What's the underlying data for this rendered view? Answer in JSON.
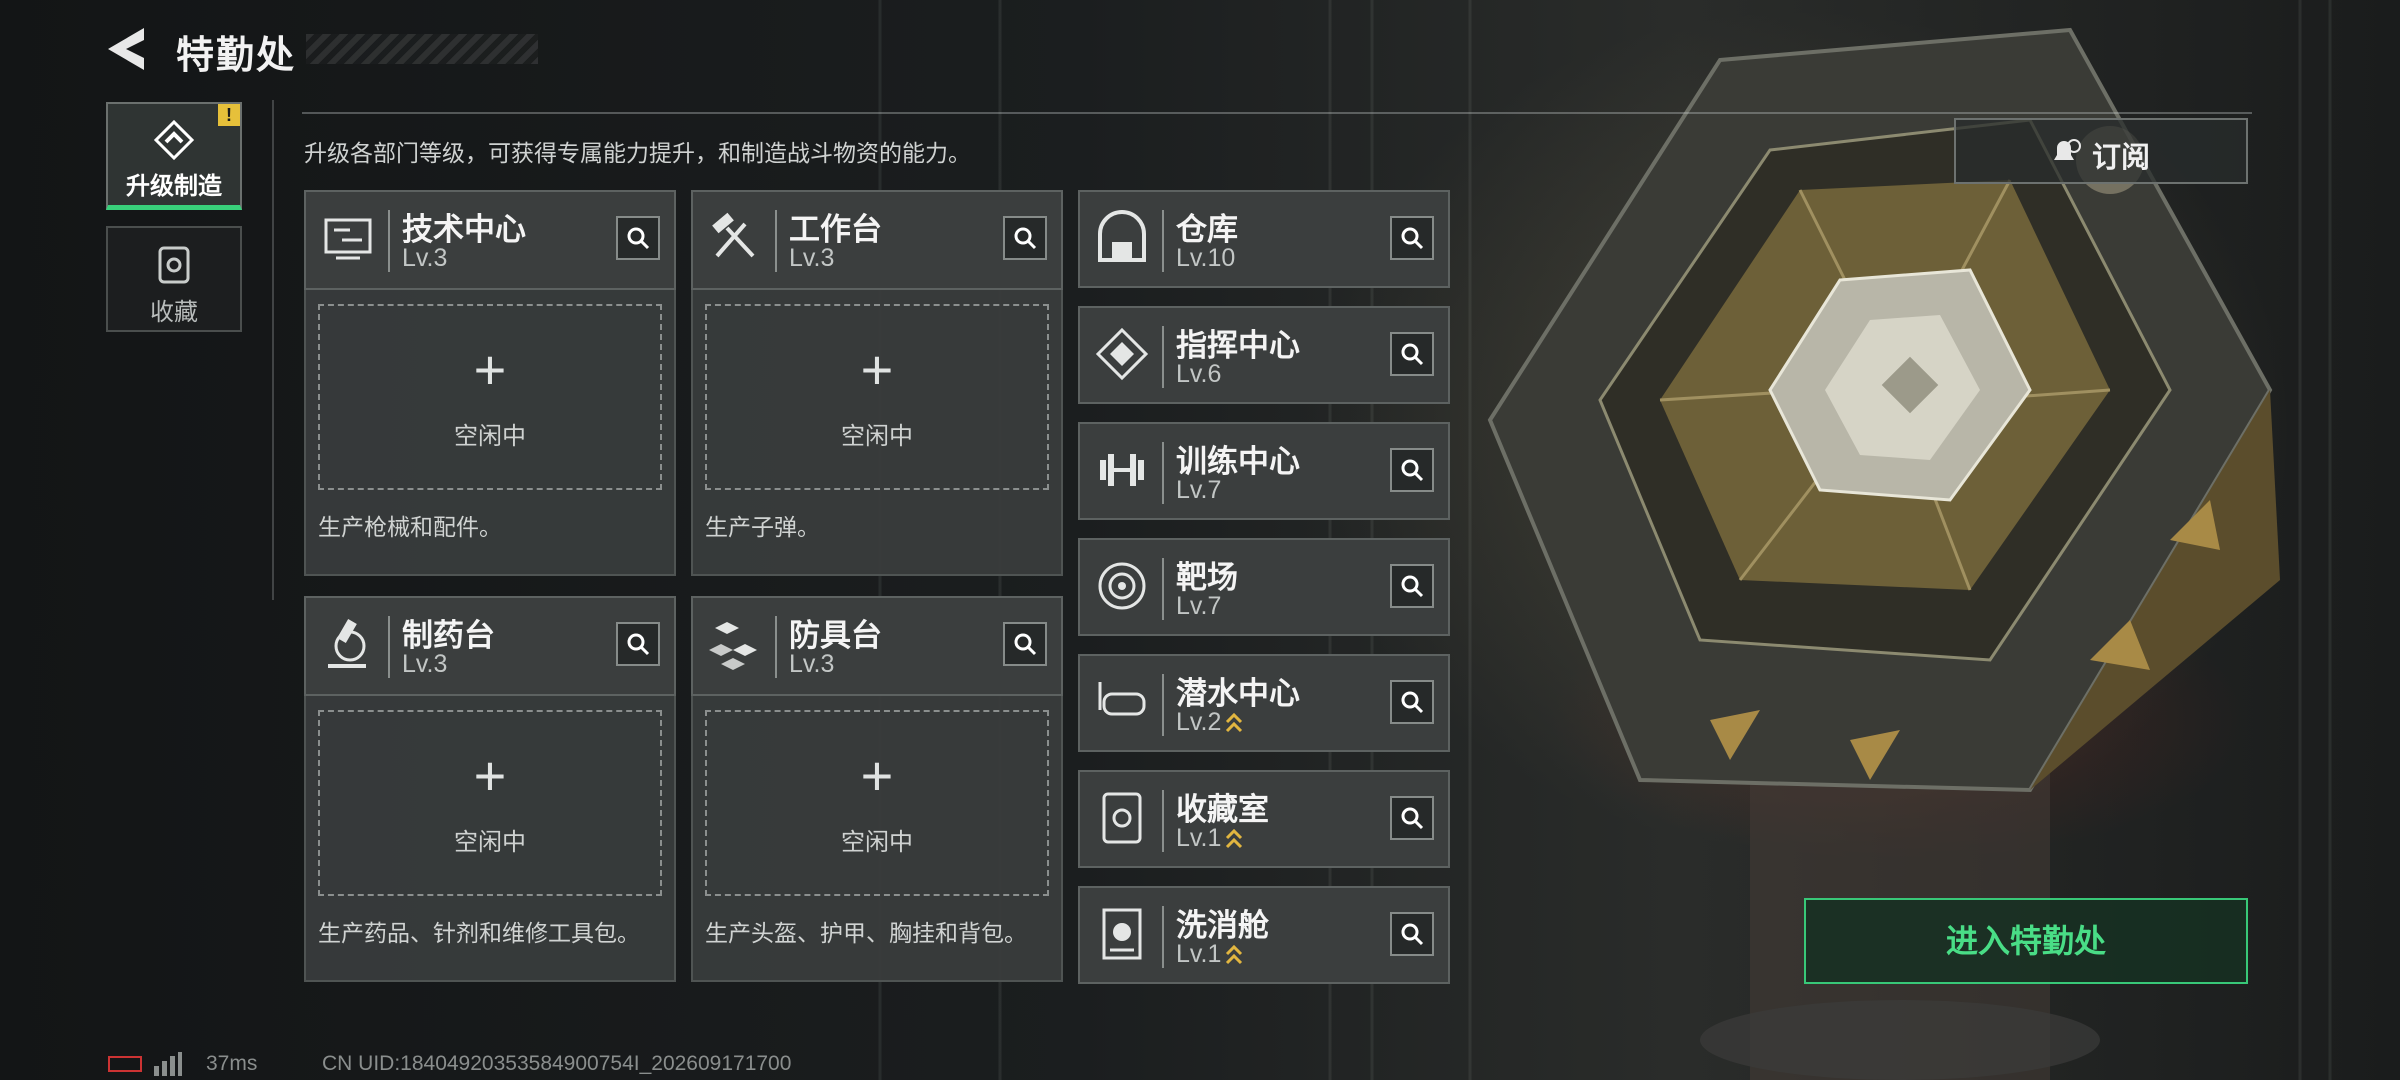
{
  "header": {
    "title": "特勤处"
  },
  "tabs": [
    {
      "label": "升级制造",
      "badge": "!",
      "icon": "upgrade-icon"
    },
    {
      "label": "收藏",
      "icon": "collection-icon"
    }
  ],
  "intro": "升级各部门等级，可获得专属能力提升，和制造战斗物资的能力。",
  "production_depts": [
    {
      "name": "技术中心",
      "level": "Lv.3",
      "icon": "tech-center-icon",
      "slot_label": "空闲中",
      "desc": "生产枪械和配件。"
    },
    {
      "name": "工作台",
      "level": "Lv.3",
      "icon": "workbench-icon",
      "slot_label": "空闲中",
      "desc": "生产子弹。"
    },
    {
      "name": "制药台",
      "level": "Lv.3",
      "icon": "pharmacy-icon",
      "slot_label": "空闲中",
      "desc": "生产药品、针剂和维修工具包。"
    },
    {
      "name": "防具台",
      "level": "Lv.3",
      "icon": "armor-bench-icon",
      "slot_label": "空闲中",
      "desc": "生产头盔、护甲、胸挂和背包。"
    }
  ],
  "facilities": [
    {
      "name": "仓库",
      "level": "Lv.10",
      "icon": "warehouse-icon",
      "upgradable": false
    },
    {
      "name": "指挥中心",
      "level": "Lv.6",
      "icon": "command-center-icon",
      "upgradable": false
    },
    {
      "name": "训练中心",
      "level": "Lv.7",
      "icon": "training-center-icon",
      "upgradable": false
    },
    {
      "name": "靶场",
      "level": "Lv.7",
      "icon": "shooting-range-icon",
      "upgradable": false
    },
    {
      "name": "潜水中心",
      "level": "Lv.2",
      "icon": "diving-center-icon",
      "upgradable": true
    },
    {
      "name": "收藏室",
      "level": "Lv.1",
      "icon": "collection-room-icon",
      "upgradable": true
    },
    {
      "name": "洗消舱",
      "level": "Lv.1",
      "icon": "decon-chamber-icon",
      "upgradable": true
    }
  ],
  "subscribe": {
    "label": "订阅"
  },
  "enter_button": {
    "label": "进入特勤处"
  },
  "status": {
    "ping": "37ms",
    "uid": "CN UID:18404920353584900754I_202609171700"
  },
  "colors": {
    "accent_green": "#38d07a",
    "upgrade_gold": "#e2b640",
    "badge_yellow": "#e6c03a"
  }
}
